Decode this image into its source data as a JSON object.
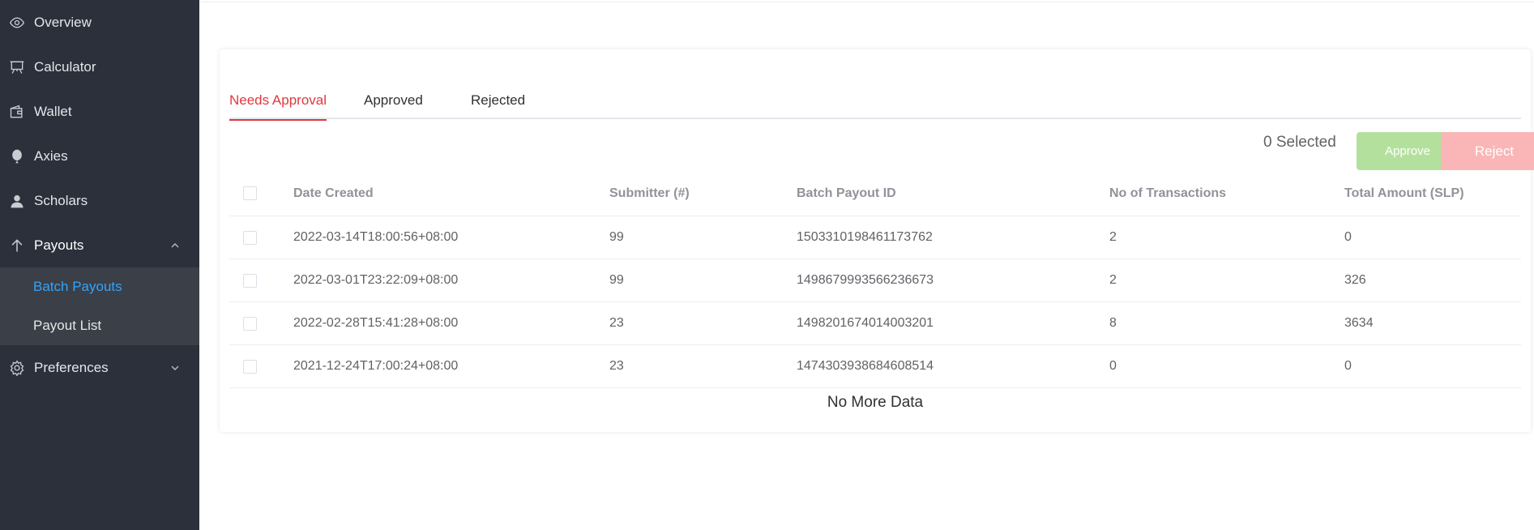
{
  "sidebar": {
    "items": [
      {
        "label": "Overview",
        "icon": "eye-icon"
      },
      {
        "label": "Calculator",
        "icon": "easel-icon"
      },
      {
        "label": "Wallet",
        "icon": "wallet-icon"
      },
      {
        "label": "Axies",
        "icon": "balloon-icon"
      },
      {
        "label": "Scholars",
        "icon": "user-icon"
      },
      {
        "label": "Payouts",
        "icon": "arrow-up-icon",
        "expanded": true,
        "children": [
          {
            "label": "Batch Payouts",
            "active": true
          },
          {
            "label": "Payout List"
          }
        ]
      },
      {
        "label": "Preferences",
        "icon": "gear-icon",
        "expanded": false
      }
    ]
  },
  "tabs": [
    {
      "label": "Needs Approval",
      "active": true
    },
    {
      "label": "Approved"
    },
    {
      "label": "Rejected"
    }
  ],
  "toolbar": {
    "selected_text": "0 Selected",
    "approve_label": "Approve",
    "reject_label": "Reject"
  },
  "table": {
    "headers": [
      "Date Created",
      "Submitter (#)",
      "Batch Payout ID",
      "No of Transactions",
      "Total Amount (SLP)"
    ],
    "rows": [
      [
        "2022-03-14T18:00:56+08:00",
        "99",
        "1503310198461173762",
        "2",
        "0"
      ],
      [
        "2022-03-01T23:22:09+08:00",
        "99",
        "1498679993566236673",
        "2",
        "326"
      ],
      [
        "2022-02-28T15:41:28+08:00",
        "23",
        "1498201674014003201",
        "8",
        "3634"
      ],
      [
        "2021-12-24T17:00:24+08:00",
        "23",
        "1474303938684608514",
        "0",
        "0"
      ]
    ],
    "footer": "No More Data"
  },
  "colors": {
    "sidebar_bg": "#2b303b",
    "submenu_bg": "#3a3f48",
    "active_link": "#36a3f7",
    "tab_active": "#e0383e",
    "approve_bg": "#b3e19d",
    "reject_bg": "#fab6b6"
  }
}
